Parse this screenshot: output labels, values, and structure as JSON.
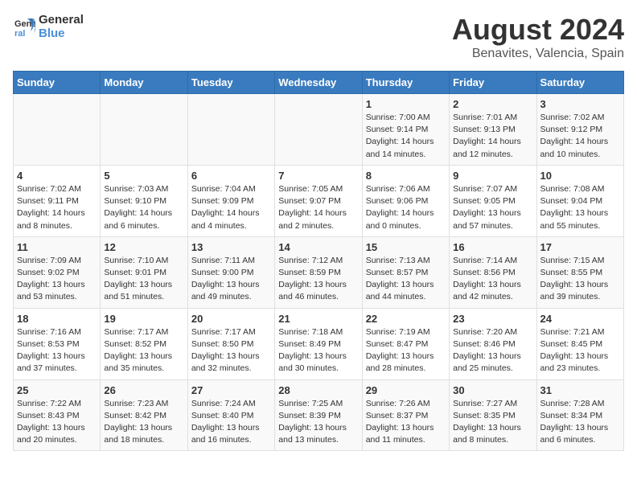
{
  "logo": {
    "line1": "General",
    "line2": "Blue"
  },
  "title": "August 2024",
  "subtitle": "Benavites, Valencia, Spain",
  "days_of_week": [
    "Sunday",
    "Monday",
    "Tuesday",
    "Wednesday",
    "Thursday",
    "Friday",
    "Saturday"
  ],
  "weeks": [
    [
      {
        "day": "",
        "content": ""
      },
      {
        "day": "",
        "content": ""
      },
      {
        "day": "",
        "content": ""
      },
      {
        "day": "",
        "content": ""
      },
      {
        "day": "1",
        "content": "Sunrise: 7:00 AM\nSunset: 9:14 PM\nDaylight: 14 hours\nand 14 minutes."
      },
      {
        "day": "2",
        "content": "Sunrise: 7:01 AM\nSunset: 9:13 PM\nDaylight: 14 hours\nand 12 minutes."
      },
      {
        "day": "3",
        "content": "Sunrise: 7:02 AM\nSunset: 9:12 PM\nDaylight: 14 hours\nand 10 minutes."
      }
    ],
    [
      {
        "day": "4",
        "content": "Sunrise: 7:02 AM\nSunset: 9:11 PM\nDaylight: 14 hours\nand 8 minutes."
      },
      {
        "day": "5",
        "content": "Sunrise: 7:03 AM\nSunset: 9:10 PM\nDaylight: 14 hours\nand 6 minutes."
      },
      {
        "day": "6",
        "content": "Sunrise: 7:04 AM\nSunset: 9:09 PM\nDaylight: 14 hours\nand 4 minutes."
      },
      {
        "day": "7",
        "content": "Sunrise: 7:05 AM\nSunset: 9:07 PM\nDaylight: 14 hours\nand 2 minutes."
      },
      {
        "day": "8",
        "content": "Sunrise: 7:06 AM\nSunset: 9:06 PM\nDaylight: 14 hours\nand 0 minutes."
      },
      {
        "day": "9",
        "content": "Sunrise: 7:07 AM\nSunset: 9:05 PM\nDaylight: 13 hours\nand 57 minutes."
      },
      {
        "day": "10",
        "content": "Sunrise: 7:08 AM\nSunset: 9:04 PM\nDaylight: 13 hours\nand 55 minutes."
      }
    ],
    [
      {
        "day": "11",
        "content": "Sunrise: 7:09 AM\nSunset: 9:02 PM\nDaylight: 13 hours\nand 53 minutes."
      },
      {
        "day": "12",
        "content": "Sunrise: 7:10 AM\nSunset: 9:01 PM\nDaylight: 13 hours\nand 51 minutes."
      },
      {
        "day": "13",
        "content": "Sunrise: 7:11 AM\nSunset: 9:00 PM\nDaylight: 13 hours\nand 49 minutes."
      },
      {
        "day": "14",
        "content": "Sunrise: 7:12 AM\nSunset: 8:59 PM\nDaylight: 13 hours\nand 46 minutes."
      },
      {
        "day": "15",
        "content": "Sunrise: 7:13 AM\nSunset: 8:57 PM\nDaylight: 13 hours\nand 44 minutes."
      },
      {
        "day": "16",
        "content": "Sunrise: 7:14 AM\nSunset: 8:56 PM\nDaylight: 13 hours\nand 42 minutes."
      },
      {
        "day": "17",
        "content": "Sunrise: 7:15 AM\nSunset: 8:55 PM\nDaylight: 13 hours\nand 39 minutes."
      }
    ],
    [
      {
        "day": "18",
        "content": "Sunrise: 7:16 AM\nSunset: 8:53 PM\nDaylight: 13 hours\nand 37 minutes."
      },
      {
        "day": "19",
        "content": "Sunrise: 7:17 AM\nSunset: 8:52 PM\nDaylight: 13 hours\nand 35 minutes."
      },
      {
        "day": "20",
        "content": "Sunrise: 7:17 AM\nSunset: 8:50 PM\nDaylight: 13 hours\nand 32 minutes."
      },
      {
        "day": "21",
        "content": "Sunrise: 7:18 AM\nSunset: 8:49 PM\nDaylight: 13 hours\nand 30 minutes."
      },
      {
        "day": "22",
        "content": "Sunrise: 7:19 AM\nSunset: 8:47 PM\nDaylight: 13 hours\nand 28 minutes."
      },
      {
        "day": "23",
        "content": "Sunrise: 7:20 AM\nSunset: 8:46 PM\nDaylight: 13 hours\nand 25 minutes."
      },
      {
        "day": "24",
        "content": "Sunrise: 7:21 AM\nSunset: 8:45 PM\nDaylight: 13 hours\nand 23 minutes."
      }
    ],
    [
      {
        "day": "25",
        "content": "Sunrise: 7:22 AM\nSunset: 8:43 PM\nDaylight: 13 hours\nand 20 minutes."
      },
      {
        "day": "26",
        "content": "Sunrise: 7:23 AM\nSunset: 8:42 PM\nDaylight: 13 hours\nand 18 minutes."
      },
      {
        "day": "27",
        "content": "Sunrise: 7:24 AM\nSunset: 8:40 PM\nDaylight: 13 hours\nand 16 minutes."
      },
      {
        "day": "28",
        "content": "Sunrise: 7:25 AM\nSunset: 8:39 PM\nDaylight: 13 hours\nand 13 minutes."
      },
      {
        "day": "29",
        "content": "Sunrise: 7:26 AM\nSunset: 8:37 PM\nDaylight: 13 hours\nand 11 minutes."
      },
      {
        "day": "30",
        "content": "Sunrise: 7:27 AM\nSunset: 8:35 PM\nDaylight: 13 hours\nand 8 minutes."
      },
      {
        "day": "31",
        "content": "Sunrise: 7:28 AM\nSunset: 8:34 PM\nDaylight: 13 hours\nand 6 minutes."
      }
    ]
  ]
}
